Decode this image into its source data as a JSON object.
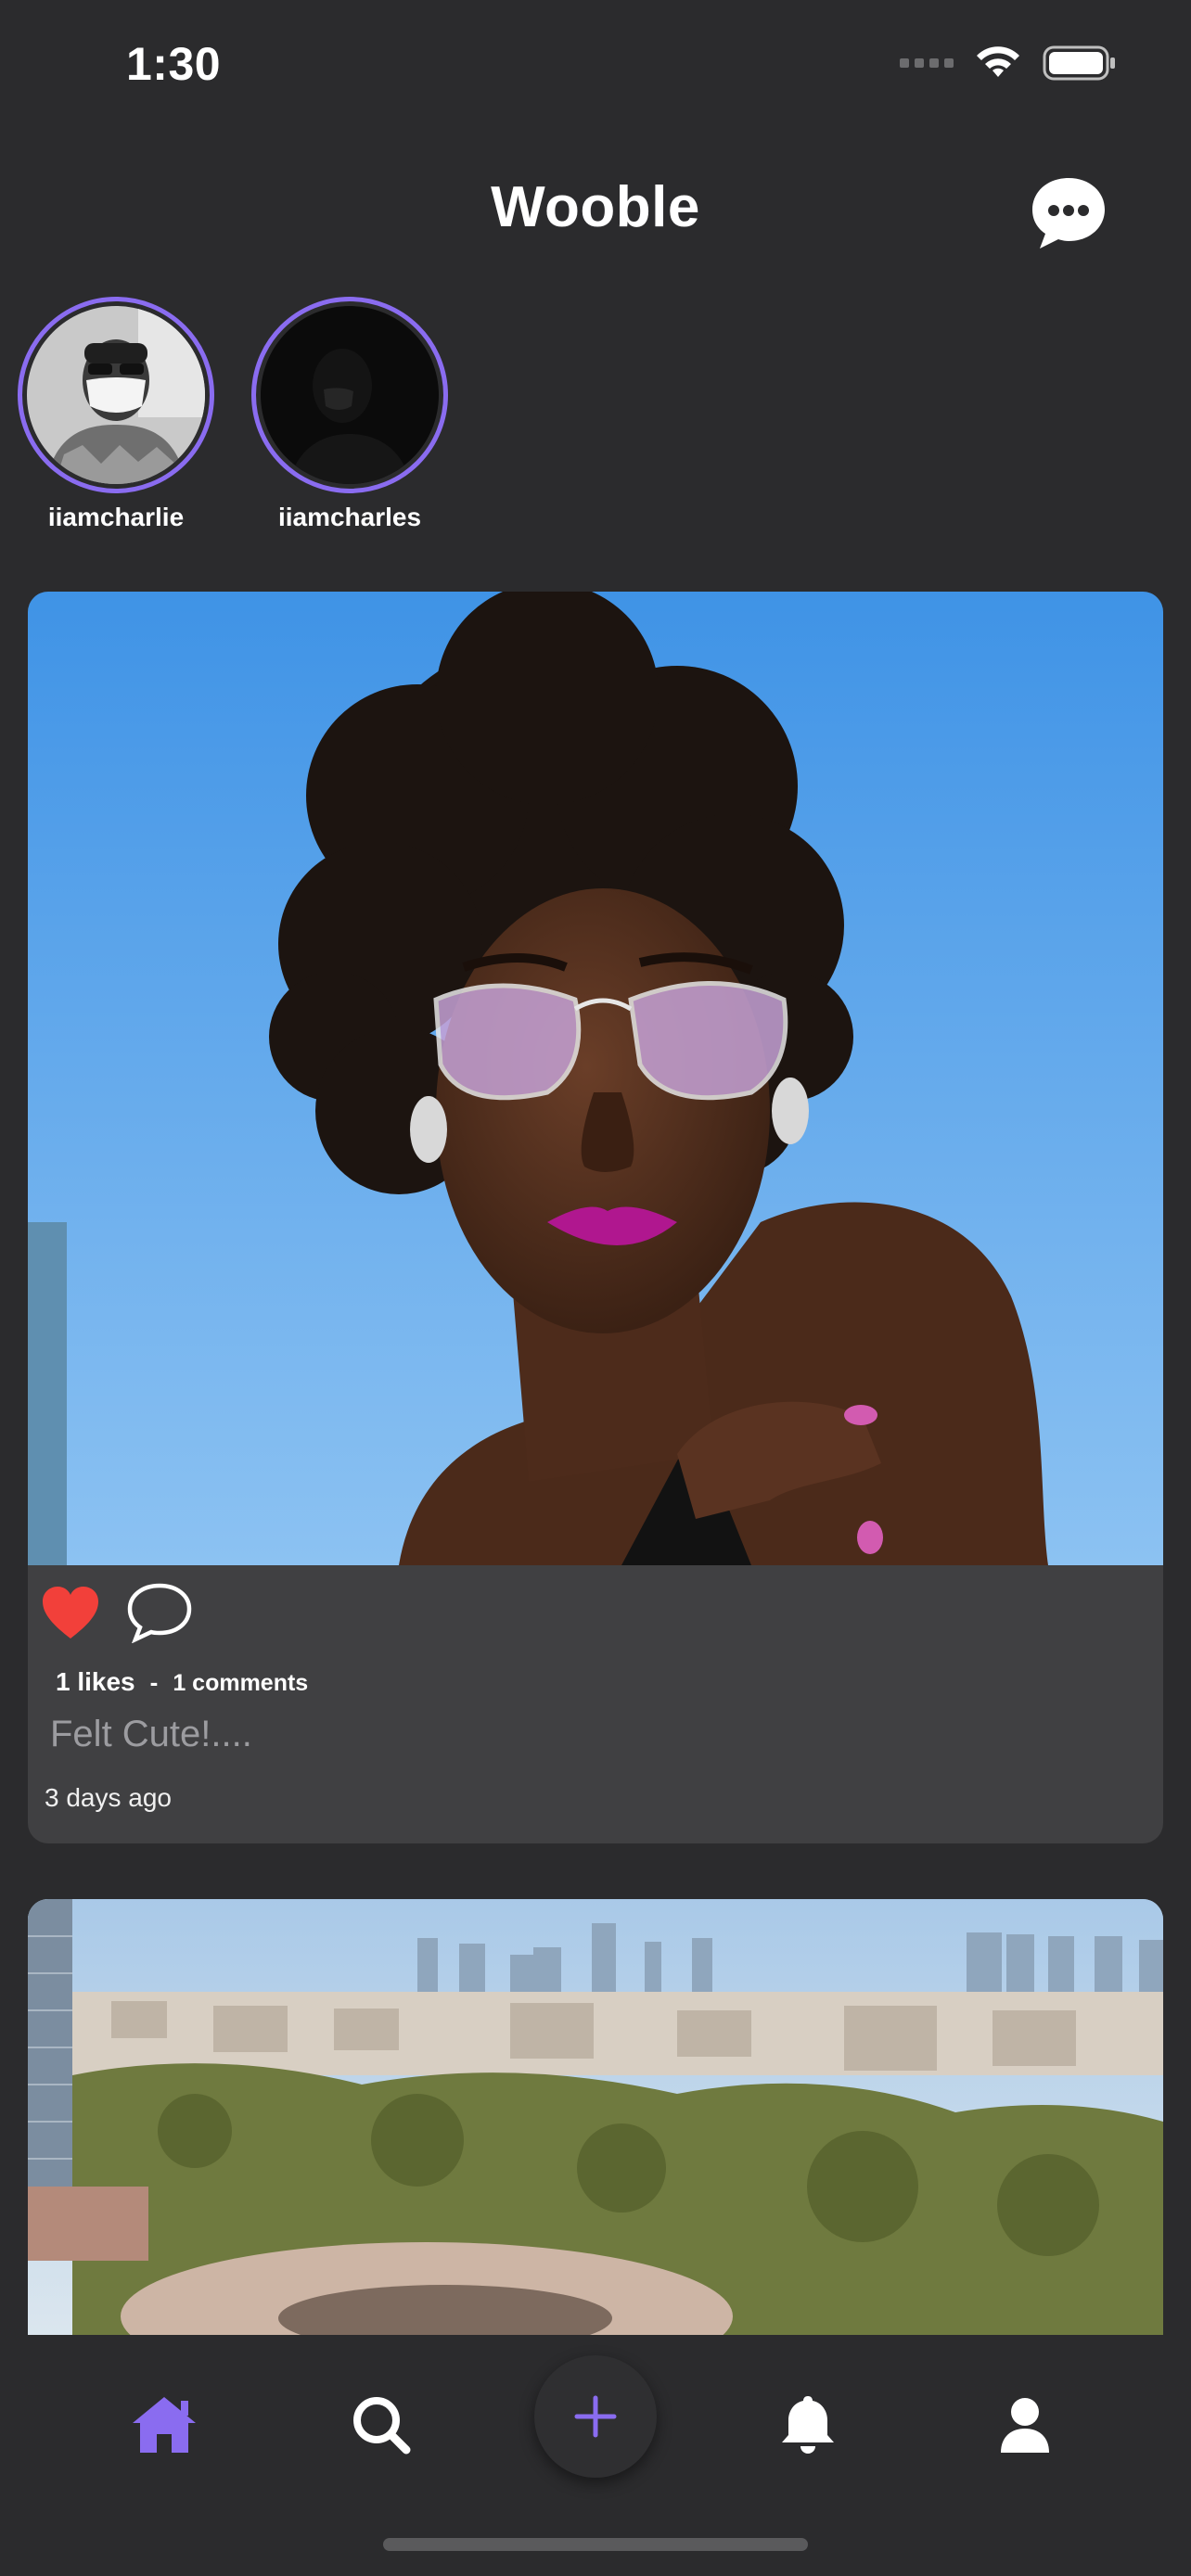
{
  "status_bar": {
    "time": "1:30",
    "icons": [
      "signal-icon",
      "wifi-icon",
      "battery-icon"
    ]
  },
  "header": {
    "title": "Wooble",
    "messages_icon": "chat-bubble-icon"
  },
  "stories": [
    {
      "username": "iiamcharlie"
    },
    {
      "username": "iiamcharles"
    }
  ],
  "posts": [
    {
      "image": "portrait-woman-sunglasses",
      "liked": true,
      "likes_text": "1 likes",
      "separator": "-",
      "comments_text": "1 comments",
      "caption": "Felt Cute!....",
      "time_ago": "3 days ago"
    },
    {
      "image": "city-skyline-stadium"
    }
  ],
  "tab_bar": {
    "items": [
      "home-icon",
      "search-icon",
      "add-icon",
      "bell-icon",
      "profile-icon"
    ],
    "active": "home"
  },
  "colors": {
    "background": "#2b2b2d",
    "card": "#404042",
    "accent": "#8a6cf0",
    "like": "#f2403a",
    "caption": "#9c9ca0"
  }
}
